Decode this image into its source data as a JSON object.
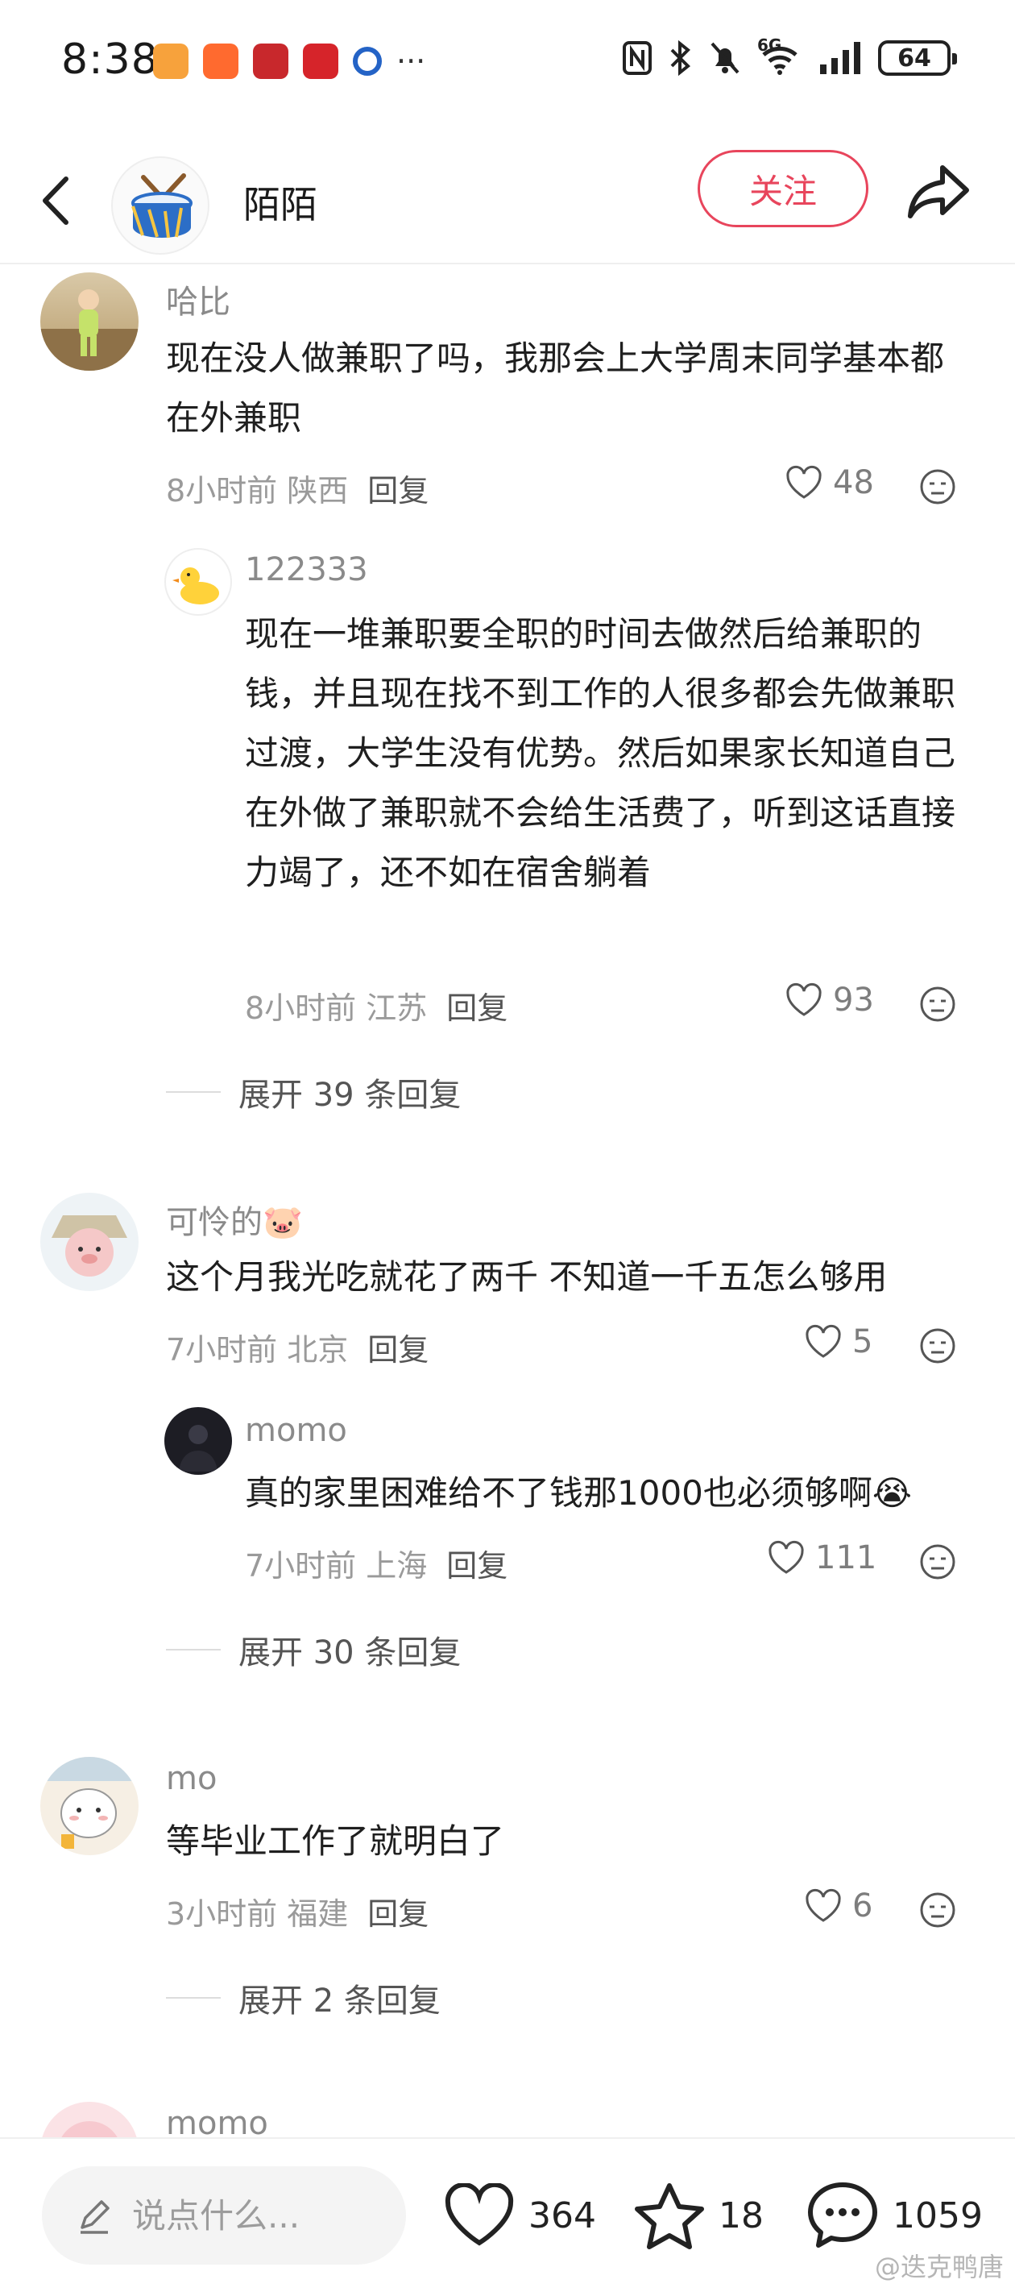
{
  "status_bar": {
    "time": "8:38",
    "battery": "64",
    "network": "6G"
  },
  "header": {
    "name": "陌陌",
    "follow_label": "关注"
  },
  "comments": [
    {
      "user": "哈比",
      "text": "现在没人做兼职了吗，我那会上大学周末同学基本都在外兼职",
      "time": "8小时前 陕西",
      "reply_label": "回复",
      "likes": "48",
      "reply": {
        "user": "122333",
        "text": "现在一堆兼职要全职的时间去做然后给兼职的钱，并且现在找不到工作的人很多都会先做兼职过渡，大学生没有优势。然后如果家长知道自己在外做了兼职就不会给生活费了，听到这话直接力竭了，还不如在宿舍躺着",
        "time": "8小时前 江苏",
        "reply_label": "回复",
        "likes": "93"
      },
      "expand": "展开 39 条回复"
    },
    {
      "user": "可怜的🐷",
      "text": "这个月我光吃就花了两千 不知道一千五怎么够用",
      "time": "7小时前 北京",
      "reply_label": "回复",
      "likes": "5",
      "reply": {
        "user": "momo",
        "text": "真的家里困难给不了钱那1000也必须够啊😭",
        "time": "7小时前 上海",
        "reply_label": "回复",
        "likes": "111"
      },
      "expand": "展开 30 条回复"
    },
    {
      "user": "mo",
      "text": "等毕业工作了就明白了",
      "time": "3小时前 福建",
      "reply_label": "回复",
      "likes": "6",
      "expand": "展开 2 条回复"
    },
    {
      "user": "momo"
    }
  ],
  "bottom_bar": {
    "placeholder": "说点什么...",
    "likes": "364",
    "favorites": "18",
    "comments": "1059"
  },
  "watermark": "@迭克鸭唐"
}
